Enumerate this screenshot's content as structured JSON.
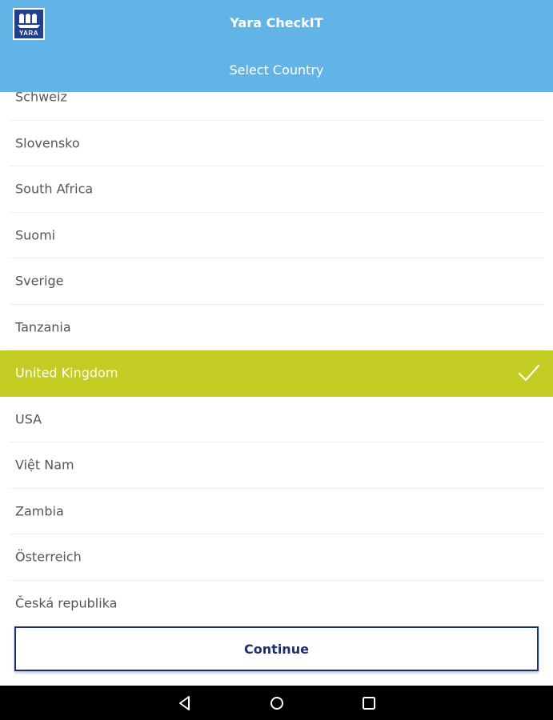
{
  "header": {
    "logo_text": "YARA",
    "app_title": "Yara CheckIT",
    "page_title": "Select Country"
  },
  "countries": [
    {
      "label": "Schweiz",
      "selected": false
    },
    {
      "label": "Slovensko",
      "selected": false
    },
    {
      "label": "South Africa",
      "selected": false
    },
    {
      "label": "Suomi",
      "selected": false
    },
    {
      "label": "Sverige",
      "selected": false
    },
    {
      "label": "Tanzania",
      "selected": false
    },
    {
      "label": "United Kingdom",
      "selected": true
    },
    {
      "label": "USA",
      "selected": false
    },
    {
      "label": "Việt Nam",
      "selected": false
    },
    {
      "label": "Zambia",
      "selected": false
    },
    {
      "label": "Österreich",
      "selected": false
    },
    {
      "label": "Česká republika",
      "selected": false
    }
  ],
  "footer": {
    "continue_label": "Continue"
  },
  "colors": {
    "header_bg": "#63b4e6",
    "selected_bg": "#c2cc22",
    "brand_navy": "#1d2f6e"
  },
  "navbar": {
    "icons": [
      "back-icon",
      "home-icon",
      "recents-icon"
    ]
  }
}
